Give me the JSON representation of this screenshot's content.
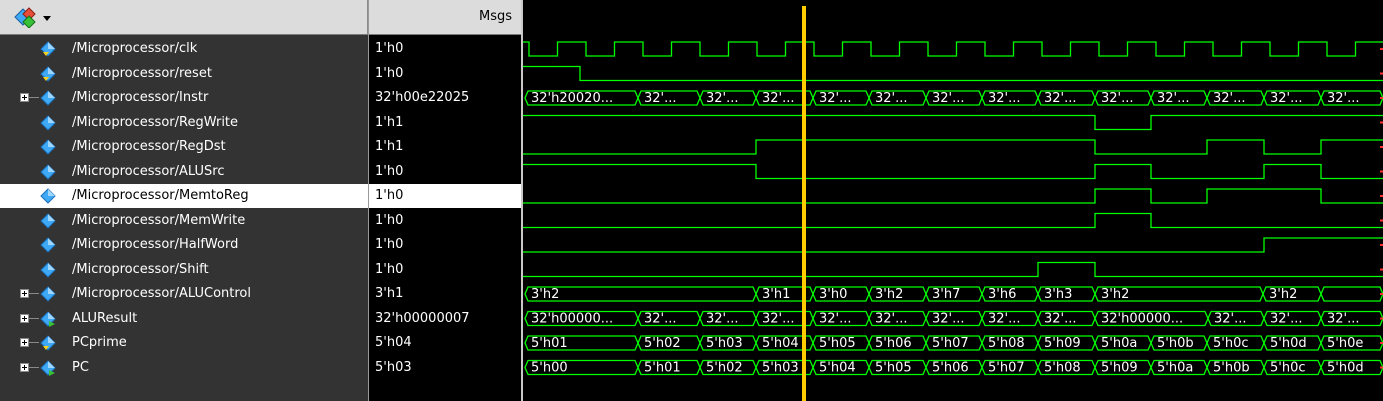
{
  "header": {
    "msgs_label": "Msgs",
    "tool_icon": "wave-tool-icon",
    "dropdown_icon": "chevron-down-icon"
  },
  "colors": {
    "wave": "#00ff00",
    "cursor": "#ffcc00",
    "icon": "#3fa9f5"
  },
  "signals": [
    {
      "name": "/Microprocessor/clk",
      "value": "1'h0",
      "type": "clock",
      "expandable": false,
      "icon": "signal-in-icon"
    },
    {
      "name": "/Microprocessor/reset",
      "value": "1'h0",
      "type": "bit",
      "expandable": false,
      "icon": "signal-in-icon",
      "transitions": [
        [
          0,
          1
        ],
        [
          1,
          0
        ]
      ]
    },
    {
      "name": "/Microprocessor/Instr",
      "value": "32'h00e22025",
      "type": "bus",
      "expandable": true,
      "icon": "signal-icon",
      "segments": [
        "32'h20020...",
        "32'...",
        "32'...",
        "32'...",
        "32'...",
        "32'...",
        "32'...",
        "32'...",
        "32'...",
        "32'...",
        "32'...",
        "32'...",
        "32'...",
        "32'..."
      ]
    },
    {
      "name": "/Microprocessor/RegWrite",
      "value": "1'h1",
      "type": "bit",
      "expandable": false,
      "icon": "signal-icon"
    },
    {
      "name": "/Microprocessor/RegDst",
      "value": "1'h1",
      "type": "bit",
      "expandable": false,
      "icon": "signal-icon"
    },
    {
      "name": "/Microprocessor/ALUSrc",
      "value": "1'h0",
      "type": "bit",
      "expandable": false,
      "icon": "signal-icon"
    },
    {
      "name": "/Microprocessor/MemtoReg",
      "value": "1'h0",
      "type": "bit",
      "expandable": false,
      "icon": "signal-icon",
      "selected": true
    },
    {
      "name": "/Microprocessor/MemWrite",
      "value": "1'h0",
      "type": "bit",
      "expandable": false,
      "icon": "signal-icon"
    },
    {
      "name": "/Microprocessor/HalfWord",
      "value": "1'h0",
      "type": "bit",
      "expandable": false,
      "icon": "signal-icon"
    },
    {
      "name": "/Microprocessor/Shift",
      "value": "1'h0",
      "type": "bit",
      "expandable": false,
      "icon": "signal-icon"
    },
    {
      "name": "/Microprocessor/ALUControl",
      "value": "3'h1",
      "type": "bus",
      "expandable": true,
      "icon": "signal-icon",
      "segments": [
        "3'h2",
        "3'h1",
        "3'h0",
        "3'h2",
        "3'h7",
        "3'h6",
        "3'h3",
        "3'h2",
        "3'h2"
      ]
    },
    {
      "name": "ALUResult",
      "value": "32'h00000007",
      "type": "bus",
      "expandable": true,
      "icon": "signal-out-icon",
      "segments": [
        "32'h00000...",
        "32'...",
        "32'...",
        "32'...",
        "32'...",
        "32'...",
        "32'...",
        "32'...",
        "32'...",
        "32'h00000...",
        "32'...",
        "32'...",
        "32'..."
      ]
    },
    {
      "name": "PCprime",
      "value": "5'h04",
      "type": "bus",
      "expandable": true,
      "icon": "signal-in-icon",
      "segments": [
        "5'h01",
        "5'h02",
        "5'h03",
        "5'h04",
        "5'h05",
        "5'h06",
        "5'h07",
        "5'h08",
        "5'h09",
        "5'h0a",
        "5'h0b",
        "5'h0c",
        "5'h0d",
        "5'h0e"
      ]
    },
    {
      "name": "PC",
      "value": "5'h03",
      "type": "bus",
      "expandable": true,
      "icon": "signal-out-icon",
      "segments": [
        "5'h00",
        "5'h01",
        "5'h02",
        "5'h03",
        "5'h04",
        "5'h05",
        "5'h06",
        "5'h07",
        "5'h08",
        "5'h09",
        "5'h0a",
        "5'h0b",
        "5'h0c",
        "5'h0d"
      ]
    }
  ]
}
